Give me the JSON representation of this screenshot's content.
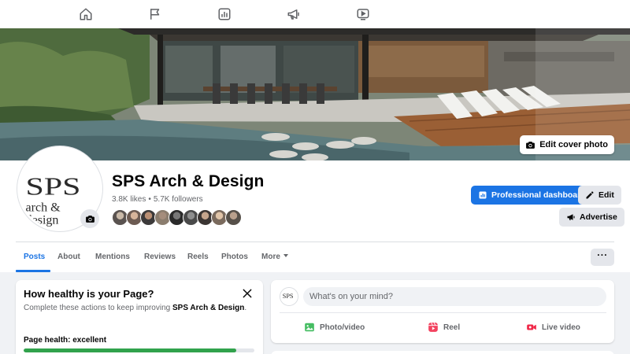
{
  "colors": {
    "accent": "#1b74e4",
    "health_fill": "#31a24c",
    "background": "#f0f2f5",
    "text_secondary": "#65676b"
  },
  "topnav": {
    "icons": [
      "home-icon",
      "flag-icon",
      "insights-icon",
      "megaphone-icon",
      "video-icon"
    ]
  },
  "cover": {
    "edit_label": "Edit cover photo",
    "icon": "camera-icon"
  },
  "profile": {
    "name": "SPS Arch & Design",
    "likes": "3.8K likes",
    "separator": "•",
    "followers": "5.7K followers",
    "avatar_lines": [
      "SPS",
      "arch &",
      "design"
    ]
  },
  "actions": {
    "professional_dashboard": "Professional dashboard",
    "edit": "Edit",
    "advertise": "Advertise"
  },
  "tabs": [
    {
      "label": "Posts",
      "active": true
    },
    {
      "label": "About",
      "active": false
    },
    {
      "label": "Mentions",
      "active": false
    },
    {
      "label": "Reviews",
      "active": false
    },
    {
      "label": "Reels",
      "active": false
    },
    {
      "label": "Photos",
      "active": false
    },
    {
      "label": "More",
      "active": false
    }
  ],
  "more_menu": {
    "label": "···"
  },
  "health": {
    "title": "How healthy is your Page?",
    "desc_prefix": "Complete these actions to keep improving ",
    "desc_page": "SPS Arch & Design",
    "desc_suffix": ".",
    "status_label": "Page health: excellent",
    "progress": 0.92
  },
  "composer": {
    "placeholder": "What's on your mind?",
    "photo_label": "Photo/video",
    "reel_label": "Reel",
    "live_label": "Live video"
  }
}
